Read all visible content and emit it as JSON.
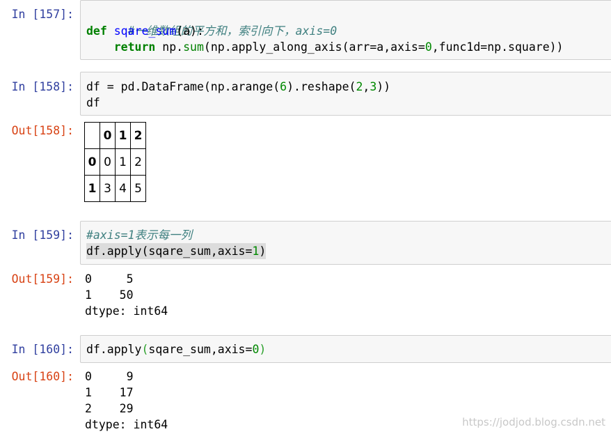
{
  "cells": [
    {
      "prompt": "In [157]:",
      "lines": {
        "comment": "#一维数组的平方和，索引向下，axis=0",
        "def_kw": "def",
        "def_name": "sqare_sum",
        "def_args": "(a):",
        "ret_kw": "return",
        "ret_pre": " np.",
        "ret_sum": "sum",
        "ret_mid": "(np.apply_along_axis(arr=a,axis=",
        "ret_zero": "0",
        "ret_post": ",func1d=np.square))"
      }
    },
    {
      "prompt": "In [158]:",
      "lines": {
        "l1_pre": "df = pd.DataFrame(np.arange(",
        "l1_six": "6",
        "l1_mid": ").reshape(",
        "l1_two": "2",
        "l1_comma": ",",
        "l1_three": "3",
        "l1_post": "))",
        "l2": "df"
      }
    },
    {
      "prompt": "Out[158]:",
      "table": {
        "columns": [
          "",
          "0",
          "1",
          "2"
        ],
        "rows": [
          {
            "index": "0",
            "values": [
              "0",
              "1",
              "2"
            ]
          },
          {
            "index": "1",
            "values": [
              "3",
              "4",
              "5"
            ]
          }
        ]
      }
    },
    {
      "prompt": "In [159]:",
      "lines": {
        "comment": "#axis=1表示每一列",
        "l2_pre": "df.apply(sqare_sum,axis=",
        "l2_one": "1",
        "l2_post": ")"
      }
    },
    {
      "prompt": "Out[159]:",
      "output": [
        "0     5",
        "1    50",
        "dtype: int64"
      ]
    },
    {
      "prompt": "In [160]:",
      "lines": {
        "l1_pre": "df.apply",
        "l1_open": "(",
        "l1_mid": "sqare_sum,axis=",
        "l1_zero": "0",
        "l1_close": ")"
      }
    },
    {
      "prompt": "Out[160]:",
      "output": [
        "0     9",
        "1    17",
        "2    29",
        "dtype: int64"
      ]
    }
  ],
  "watermark": "https://jodjod.blog.csdn.net",
  "colors": {
    "in_prompt": "#303f9f",
    "out_prompt": "#d84315",
    "keyword": "#008000",
    "function_name": "#0000ff",
    "number": "#008800",
    "comment": "#408080",
    "cell_background": "#f7f7f7"
  }
}
